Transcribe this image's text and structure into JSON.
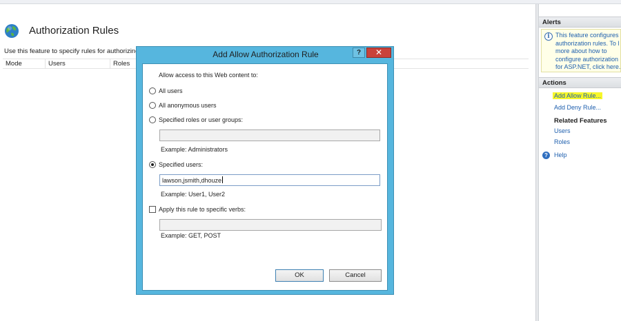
{
  "page": {
    "title": "Authorization Rules",
    "description": "Use this feature to specify rules for authorizing",
    "columns": [
      "Mode",
      "Users",
      "Roles"
    ]
  },
  "alerts": {
    "header": "Alerts",
    "message": "This feature configures\nauthorization rules. To l\nmore about how to\nconfigure authorization\nfor ASP.NET, click here."
  },
  "actions": {
    "header": "Actions",
    "add_allow": "Add Allow Rule...",
    "add_deny": "Add Deny Rule...",
    "related_header": "Related Features",
    "users": "Users",
    "roles": "Roles",
    "help": "Help"
  },
  "dialog": {
    "title": "Add Allow Authorization Rule",
    "help_button": "?",
    "close_button": "✕",
    "prompt": "Allow access to this Web content to:",
    "opt_all_users": "All users",
    "opt_anonymous": "All anonymous users",
    "opt_roles": "Specified roles or user groups:",
    "roles_value": "",
    "roles_example": "Example: Administrators",
    "opt_users": "Specified users:",
    "users_value": "lawson,jsmith,dhouze",
    "users_example": "Example: User1, User2",
    "verbs_label": "Apply this rule to specific verbs:",
    "verbs_value": "",
    "verbs_example": "Example: GET, POST",
    "ok": "OK",
    "cancel": "Cancel",
    "selected_option": "specified-users",
    "verbs_checked": false
  },
  "colors": {
    "dialog_frame": "#56b6de",
    "link": "#1e5fae",
    "highlight": "#f7f72a",
    "close_red": "#c9423a"
  }
}
